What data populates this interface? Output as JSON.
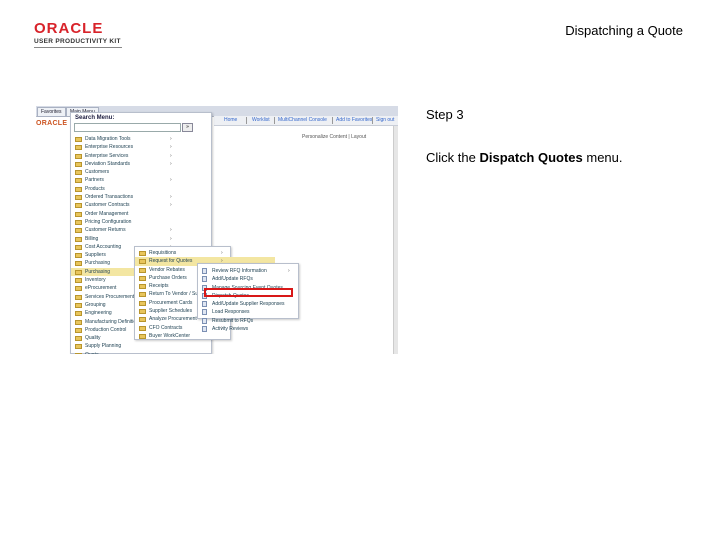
{
  "header": {
    "logo_word": "ORACLE",
    "logo_sub": "USER PRODUCTIVITY KIT",
    "title": "Dispatching a Quote",
    "brand_color": "#d8232a"
  },
  "step": {
    "label": "Step 3",
    "instruction_prefix": "Click the ",
    "instruction_target": "Dispatch Quotes",
    "instruction_suffix": " menu."
  },
  "screenshot": {
    "tabs": [
      "Favorites",
      "Main Menu"
    ],
    "nav_links": [
      "Home",
      "Worklist",
      "MultiChannel Console",
      "Add to Favorites",
      "Sign out"
    ],
    "page_logo": "ORACLE",
    "page_sub": "Personalize Content | Layout",
    "panel_title": "Search Menu:",
    "go_label": "»",
    "menu_items": [
      {
        "label": "Data Migration Tools",
        "arrow": "›"
      },
      {
        "label": "Enterprise Resources",
        "arrow": "›"
      },
      {
        "label": "Enterprise Services",
        "arrow": "›"
      },
      {
        "label": "Deviation Standards",
        "arrow": "›"
      },
      {
        "label": "Customers",
        "arrow": ""
      },
      {
        "label": "Partners",
        "arrow": "›"
      },
      {
        "label": "Products",
        "arrow": ""
      },
      {
        "label": "Ordered Transactions",
        "arrow": "›"
      },
      {
        "label": "Customer Contracts",
        "arrow": "›"
      },
      {
        "label": "Order Management",
        "arrow": ""
      },
      {
        "label": "Pricing Configuration",
        "arrow": ""
      },
      {
        "label": "Customer Returns",
        "arrow": "›"
      },
      {
        "label": "Billing",
        "arrow": "›"
      },
      {
        "label": "Cost Accounting",
        "arrow": "›"
      },
      {
        "label": "Suppliers",
        "arrow": "›"
      },
      {
        "label": "Purchasing",
        "arrow": ""
      },
      {
        "label": "Purchasing",
        "arrow": "›",
        "highlight": true
      },
      {
        "label": "Inventory",
        "arrow": ""
      },
      {
        "label": "eProcurement",
        "arrow": ""
      },
      {
        "label": "Services Procurement",
        "arrow": ""
      },
      {
        "label": "Grouping",
        "arrow": ""
      },
      {
        "label": "Engineering",
        "arrow": ""
      },
      {
        "label": "Manufacturing Definitions",
        "arrow": ""
      },
      {
        "label": "Production Control",
        "arrow": ""
      },
      {
        "label": "Quality",
        "arrow": ""
      },
      {
        "label": "Supply Planning",
        "arrow": ""
      },
      {
        "label": "Quote",
        "arrow": ""
      },
      {
        "label": "Program Management",
        "arrow": ""
      }
    ],
    "submenu1": [
      {
        "label": "Requisitions",
        "arrow": "›"
      },
      {
        "label": "Request for Quotes",
        "arrow": "›",
        "highlight": true
      },
      {
        "label": "Vendor Rebates",
        "arrow": "›"
      },
      {
        "label": "Purchase Orders",
        "arrow": "›"
      },
      {
        "label": "Receipts",
        "arrow": "›"
      },
      {
        "label": "Return To Vendor / Sum",
        "arrow": "›"
      },
      {
        "label": "Procurement Cards",
        "arrow": "›"
      },
      {
        "label": "Supplier Schedules",
        "arrow": "›"
      },
      {
        "label": "Analyze Procurement",
        "arrow": "›"
      },
      {
        "label": "CFO Contracts",
        "arrow": "›"
      },
      {
        "label": "Buyer WorkCenter",
        "arrow": ""
      }
    ],
    "submenu2": [
      {
        "label": "Review RFQ Information",
        "arrow": "›"
      },
      {
        "label": "Add/Update RFQs",
        "arrow": ""
      },
      {
        "label": "Manage Sourcing Event Quotes",
        "arrow": ""
      },
      {
        "label": "Dispatch Quotes",
        "arrow": "",
        "target": true
      },
      {
        "label": "Add/Update Supplier Responses",
        "arrow": ""
      },
      {
        "label": "Load Responses",
        "arrow": ""
      },
      {
        "label": "Resubmit to RFQs",
        "arrow": ""
      },
      {
        "label": "Activity Reviews",
        "arrow": ""
      }
    ]
  }
}
